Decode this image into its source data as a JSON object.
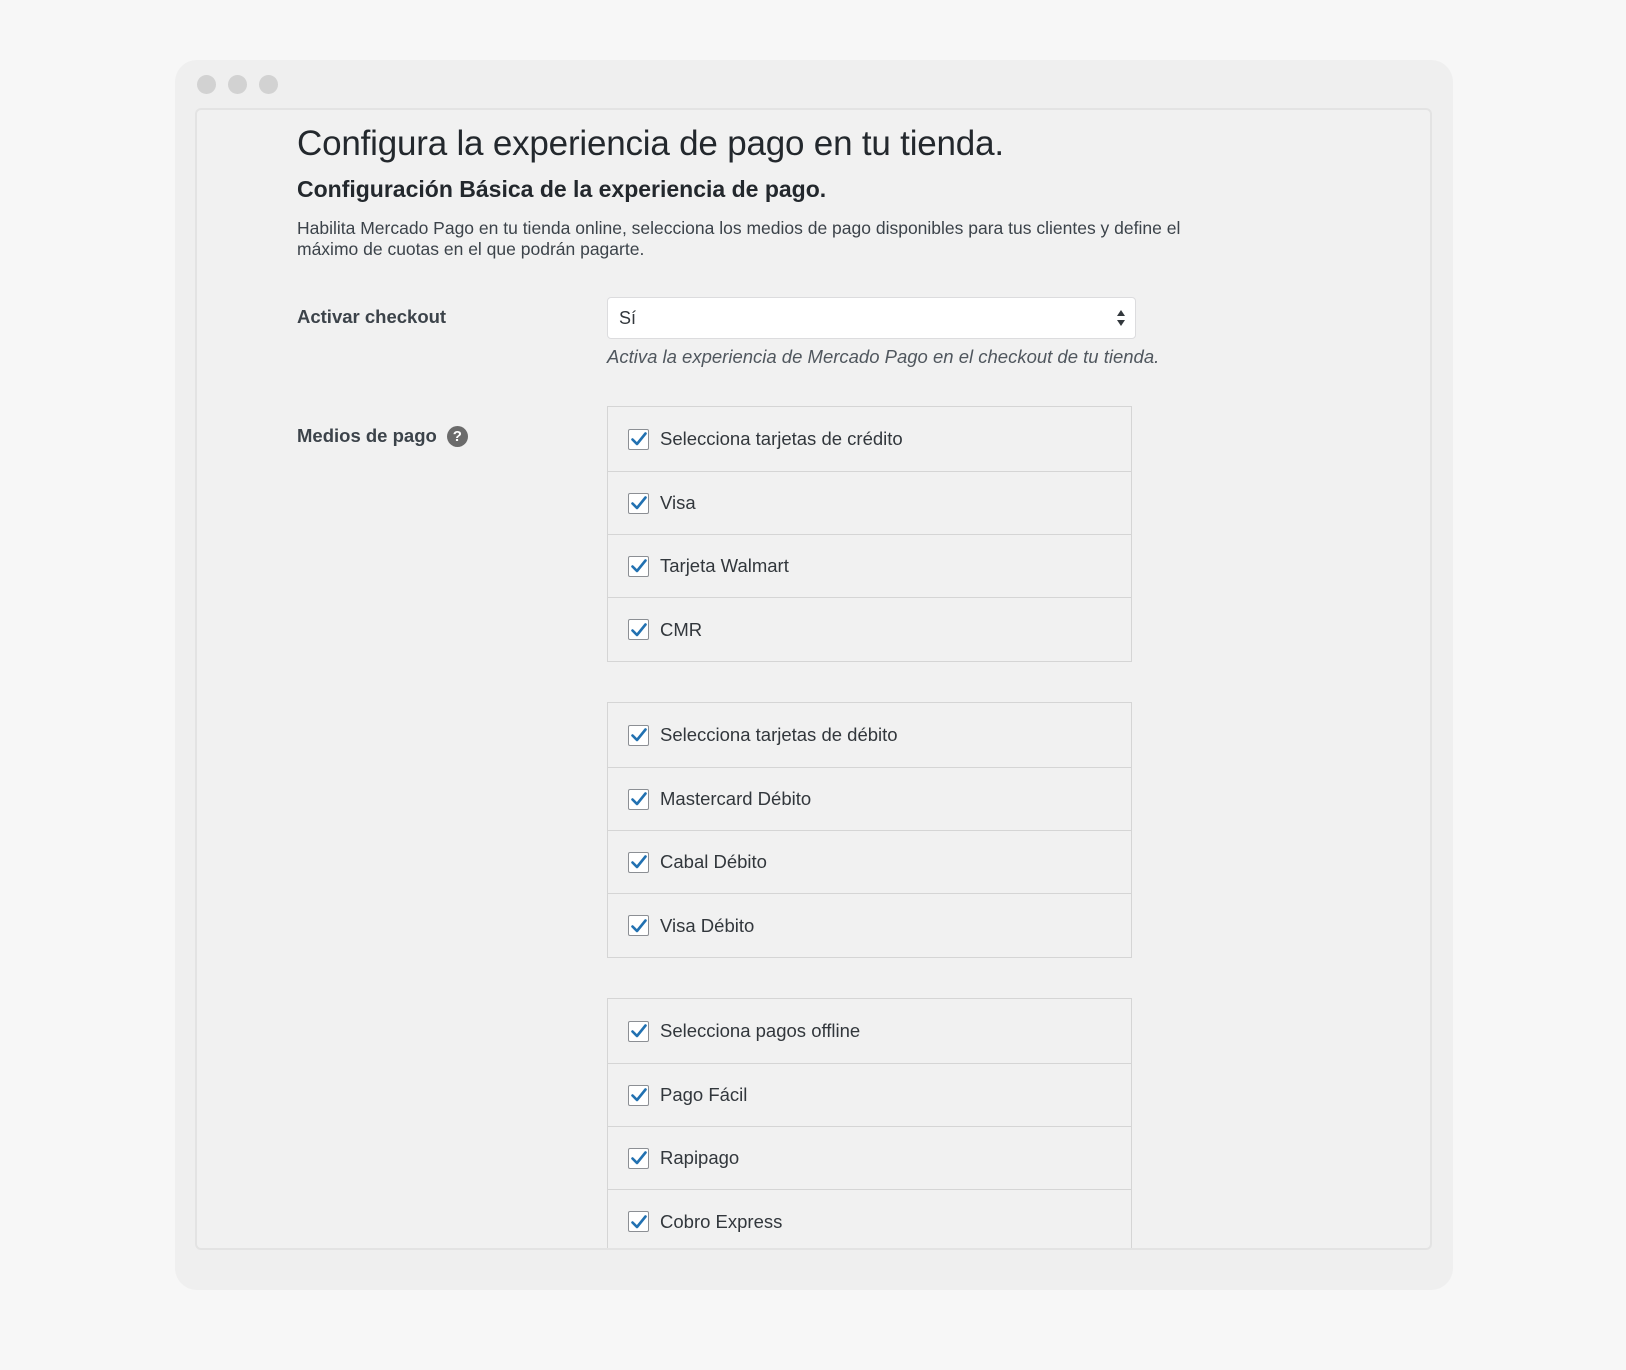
{
  "page": {
    "title": "Configura la experiencia de pago en tu tienda.",
    "section_title": "Configuración Básica de la experiencia de pago.",
    "section_description": "Habilita Mercado Pago en tu tienda online, selecciona los medios de pago disponibles para tus clientes y define el máximo de cuotas en el que podrán pagarte."
  },
  "activar_checkout": {
    "label": "Activar checkout",
    "selected": "Sí",
    "help": "Activa la experiencia de Mercado Pago en el checkout de tu tienda."
  },
  "medios_de_pago": {
    "label": "Medios de pago",
    "help_icon": "?",
    "credit": {
      "header": "Selecciona tarjetas de crédito",
      "items": [
        "Visa",
        "Tarjeta Walmart",
        "CMR"
      ]
    },
    "debit": {
      "header": "Selecciona tarjetas de débito",
      "items": [
        "Mastercard Débito",
        "Cabal Débito",
        "Visa Débito"
      ]
    },
    "offline": {
      "header": "Selecciona pagos offline",
      "items": [
        "Pago Fácil",
        "Rapipago",
        "Cobro Express"
      ]
    }
  },
  "colors": {
    "checkmark": "#2271b1",
    "window_bg": "#efefef",
    "page_bg": "#f7f7f7"
  },
  "icons": {
    "checkbox": "checkmark-icon",
    "help": "question-circle-icon",
    "select": "sort-arrows-icon"
  }
}
